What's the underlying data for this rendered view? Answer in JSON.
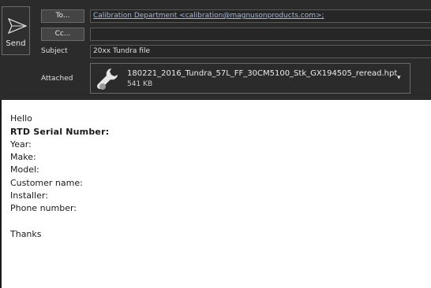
{
  "header": {
    "send_label": "Send",
    "to_button": "To...",
    "cc_button": "Cc...",
    "to_value": "Calibration Department <calibration@magnusonproducts.com>;",
    "cc_value": "",
    "subject_label": "Subject",
    "subject_value": "20xx Tundra file",
    "attached_label": "Attached",
    "attachment": {
      "name": "180221_2016_Tundra_57L_FF_30CM5100_Stk_GX194505_reread.hpt",
      "size": "541 KB",
      "icon": "wrench-icon"
    }
  },
  "body": {
    "greeting": "Hello",
    "serial": "RTD Serial Number:",
    "year": "Year:",
    "make": "Make:",
    "model": "Model:",
    "customer": "Customer name:",
    "installer": "Installer:",
    "phone": "Phone number:",
    "closing": "Thanks"
  },
  "colors": {
    "header_bg": "#2b2b2b",
    "link": "#9fb8e0",
    "body_bg": "#ffffff"
  }
}
